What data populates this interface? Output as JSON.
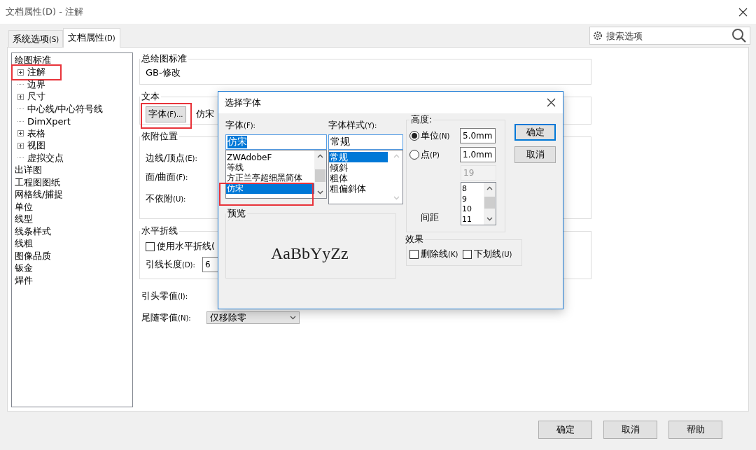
{
  "window": {
    "title": "文档属性(D) - 注解"
  },
  "search": {
    "placeholder": "搜索选项"
  },
  "tabs": [
    {
      "label": "系统选项",
      "key": "(S)",
      "selected": false
    },
    {
      "label": "文档属性",
      "key": "(D)",
      "selected": true
    }
  ],
  "tree": [
    {
      "label": "绘图标准",
      "children": [
        {
          "label": "注解",
          "expanded": false,
          "highlighted": true
        },
        {
          "label": "边界"
        },
        {
          "label": "尺寸",
          "expanded": false
        },
        {
          "label": "中心线/中心符号线"
        },
        {
          "label": "DimXpert"
        },
        {
          "label": "表格",
          "expanded": false
        },
        {
          "label": "视图",
          "expanded": false
        },
        {
          "label": "虚拟交点"
        }
      ]
    },
    {
      "label": "出详图"
    },
    {
      "label": "工程图图纸"
    },
    {
      "label": "网格线/捕捉"
    },
    {
      "label": "单位"
    },
    {
      "label": "线型"
    },
    {
      "label": "线条样式"
    },
    {
      "label": "线粗"
    },
    {
      "label": "图像品质"
    },
    {
      "label": "钣金"
    },
    {
      "label": "焊件"
    }
  ],
  "drawing_standard": {
    "title": "总绘图标准",
    "value": "GB-修改"
  },
  "text_group": {
    "title": "文本",
    "font_button": {
      "label": "字体",
      "key": "(F)...",
      "highlighted": true
    },
    "font_name": "仿宋"
  },
  "attachment": {
    "title": "依附位置",
    "rows": [
      {
        "label": "边线/顶点",
        "key": "(E):"
      },
      {
        "label": "面/曲面",
        "key": "(F):"
      },
      {
        "label": "不依附",
        "key": "(U):"
      }
    ]
  },
  "leader": {
    "title": "水平折线",
    "checkbox": {
      "label": "使用水平折线(",
      "checked": false
    },
    "length": {
      "label": "引线长度",
      "key": "(D):",
      "value": "6"
    }
  },
  "zeros": [
    {
      "label": "引头零值",
      "key": "(I):"
    },
    {
      "label": "尾随零值",
      "key": "(N):",
      "value": "仅移除零"
    }
  ],
  "footer_buttons": [
    "确定",
    "取消",
    "帮助"
  ],
  "dialog": {
    "title": "选择字体",
    "font": {
      "label": "字体",
      "key": "(F):",
      "value": "仿宋",
      "items": [
        {
          "label": "ZWAdobeF",
          "selected": false,
          "highlighted": false
        },
        {
          "label": "等线",
          "selected": false,
          "highlighted": false
        },
        {
          "label": "方正兰亭超细黑简体",
          "selected": false,
          "highlighted": false
        },
        {
          "label": "仿宋",
          "selected": true,
          "highlighted": true
        }
      ]
    },
    "style": {
      "label": "字体样式",
      "key": "(Y):",
      "value": "常规",
      "items": [
        {
          "label": "常规",
          "selected": true
        },
        {
          "label": "倾斜",
          "selected": false
        },
        {
          "label": "粗体",
          "selected": false
        },
        {
          "label": "粗偏斜体",
          "selected": false
        }
      ]
    },
    "height": {
      "title": "高度:",
      "options": [
        {
          "label": "单位",
          "key": "(N)",
          "selected": true,
          "value": "5.0mm"
        },
        {
          "label": "点",
          "key": "(P)",
          "selected": false,
          "value": "1.0mm"
        }
      ],
      "points_value": "19",
      "spacing_label": "间距",
      "spacing_items": [
        "8",
        "9",
        "10",
        "11"
      ]
    },
    "buttons": [
      {
        "label": "确定",
        "default": true
      },
      {
        "label": "取消",
        "default": false
      }
    ],
    "preview": {
      "title": "预览",
      "sample": "AaBbYyZz"
    },
    "effects": {
      "title": "效果",
      "options": [
        {
          "label": "删除线",
          "key": "(K)",
          "checked": false
        },
        {
          "label": "下划线",
          "key": "(U)",
          "checked": false
        }
      ]
    }
  }
}
